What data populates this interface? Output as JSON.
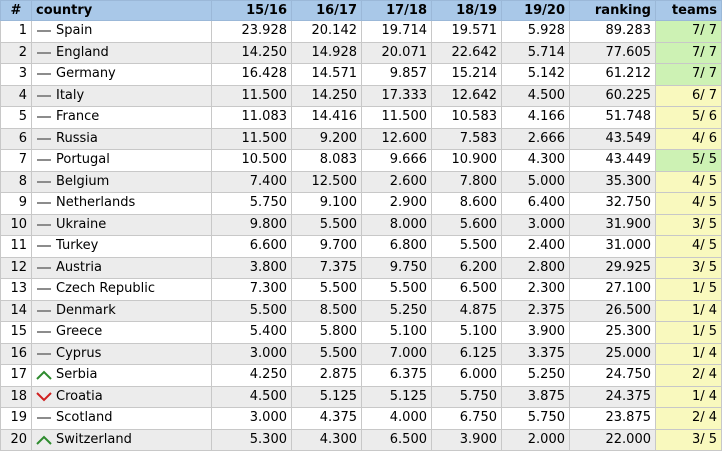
{
  "headers": {
    "rank": "#",
    "country": "country",
    "s1516": "15/16",
    "s1617": "16/17",
    "s1718": "17/18",
    "s1819": "18/19",
    "s1920": "19/20",
    "ranking": "ranking",
    "teams": "teams"
  },
  "colors": {
    "header_bg": "#a9c8e8",
    "teams_full": "#cdf2b4",
    "teams_partial": "#f9f9be",
    "up": "#2e8b2e",
    "down": "#d02020",
    "same": "#8c8c8c"
  },
  "rows": [
    {
      "rank": "1",
      "trend": "same",
      "country": "Spain",
      "s1516": "23.928",
      "s1617": "20.142",
      "s1718": "19.714",
      "s1819": "19.571",
      "s1920": "5.928",
      "ranking": "89.283",
      "teams": "7/ 7",
      "teams_status": "full"
    },
    {
      "rank": "2",
      "trend": "same",
      "country": "England",
      "s1516": "14.250",
      "s1617": "14.928",
      "s1718": "20.071",
      "s1819": "22.642",
      "s1920": "5.714",
      "ranking": "77.605",
      "teams": "7/ 7",
      "teams_status": "full"
    },
    {
      "rank": "3",
      "trend": "same",
      "country": "Germany",
      "s1516": "16.428",
      "s1617": "14.571",
      "s1718": "9.857",
      "s1819": "15.214",
      "s1920": "5.142",
      "ranking": "61.212",
      "teams": "7/ 7",
      "teams_status": "full"
    },
    {
      "rank": "4",
      "trend": "same",
      "country": "Italy",
      "s1516": "11.500",
      "s1617": "14.250",
      "s1718": "17.333",
      "s1819": "12.642",
      "s1920": "4.500",
      "ranking": "60.225",
      "teams": "6/ 7",
      "teams_status": "partial"
    },
    {
      "rank": "5",
      "trend": "same",
      "country": "France",
      "s1516": "11.083",
      "s1617": "14.416",
      "s1718": "11.500",
      "s1819": "10.583",
      "s1920": "4.166",
      "ranking": "51.748",
      "teams": "5/ 6",
      "teams_status": "partial"
    },
    {
      "rank": "6",
      "trend": "same",
      "country": "Russia",
      "s1516": "11.500",
      "s1617": "9.200",
      "s1718": "12.600",
      "s1819": "7.583",
      "s1920": "2.666",
      "ranking": "43.549",
      "teams": "4/ 6",
      "teams_status": "partial"
    },
    {
      "rank": "7",
      "trend": "same",
      "country": "Portugal",
      "s1516": "10.500",
      "s1617": "8.083",
      "s1718": "9.666",
      "s1819": "10.900",
      "s1920": "4.300",
      "ranking": "43.449",
      "teams": "5/ 5",
      "teams_status": "full"
    },
    {
      "rank": "8",
      "trend": "same",
      "country": "Belgium",
      "s1516": "7.400",
      "s1617": "12.500",
      "s1718": "2.600",
      "s1819": "7.800",
      "s1920": "5.000",
      "ranking": "35.300",
      "teams": "4/ 5",
      "teams_status": "partial"
    },
    {
      "rank": "9",
      "trend": "same",
      "country": "Netherlands",
      "s1516": "5.750",
      "s1617": "9.100",
      "s1718": "2.900",
      "s1819": "8.600",
      "s1920": "6.400",
      "ranking": "32.750",
      "teams": "4/ 5",
      "teams_status": "partial"
    },
    {
      "rank": "10",
      "trend": "same",
      "country": "Ukraine",
      "s1516": "9.800",
      "s1617": "5.500",
      "s1718": "8.000",
      "s1819": "5.600",
      "s1920": "3.000",
      "ranking": "31.900",
      "teams": "3/ 5",
      "teams_status": "partial"
    },
    {
      "rank": "11",
      "trend": "same",
      "country": "Turkey",
      "s1516": "6.600",
      "s1617": "9.700",
      "s1718": "6.800",
      "s1819": "5.500",
      "s1920": "2.400",
      "ranking": "31.000",
      "teams": "4/ 5",
      "teams_status": "partial"
    },
    {
      "rank": "12",
      "trend": "same",
      "country": "Austria",
      "s1516": "3.800",
      "s1617": "7.375",
      "s1718": "9.750",
      "s1819": "6.200",
      "s1920": "2.800",
      "ranking": "29.925",
      "teams": "3/ 5",
      "teams_status": "partial"
    },
    {
      "rank": "13",
      "trend": "same",
      "country": "Czech Republic",
      "s1516": "7.300",
      "s1617": "5.500",
      "s1718": "5.500",
      "s1819": "6.500",
      "s1920": "2.300",
      "ranking": "27.100",
      "teams": "1/ 5",
      "teams_status": "partial"
    },
    {
      "rank": "14",
      "trend": "same",
      "country": "Denmark",
      "s1516": "5.500",
      "s1617": "8.500",
      "s1718": "5.250",
      "s1819": "4.875",
      "s1920": "2.375",
      "ranking": "26.500",
      "teams": "1/ 4",
      "teams_status": "partial"
    },
    {
      "rank": "15",
      "trend": "same",
      "country": "Greece",
      "s1516": "5.400",
      "s1617": "5.800",
      "s1718": "5.100",
      "s1819": "5.100",
      "s1920": "3.900",
      "ranking": "25.300",
      "teams": "1/ 5",
      "teams_status": "partial"
    },
    {
      "rank": "16",
      "trend": "same",
      "country": "Cyprus",
      "s1516": "3.000",
      "s1617": "5.500",
      "s1718": "7.000",
      "s1819": "6.125",
      "s1920": "3.375",
      "ranking": "25.000",
      "teams": "1/ 4",
      "teams_status": "partial"
    },
    {
      "rank": "17",
      "trend": "up",
      "country": "Serbia",
      "s1516": "4.250",
      "s1617": "2.875",
      "s1718": "6.375",
      "s1819": "6.000",
      "s1920": "5.250",
      "ranking": "24.750",
      "teams": "2/ 4",
      "teams_status": "partial"
    },
    {
      "rank": "18",
      "trend": "down",
      "country": "Croatia",
      "s1516": "4.500",
      "s1617": "5.125",
      "s1718": "5.125",
      "s1819": "5.750",
      "s1920": "3.875",
      "ranking": "24.375",
      "teams": "1/ 4",
      "teams_status": "partial"
    },
    {
      "rank": "19",
      "trend": "same",
      "country": "Scotland",
      "s1516": "3.000",
      "s1617": "4.375",
      "s1718": "4.000",
      "s1819": "6.750",
      "s1920": "5.750",
      "ranking": "23.875",
      "teams": "2/ 4",
      "teams_status": "partial"
    },
    {
      "rank": "20",
      "trend": "up",
      "country": "Switzerland",
      "s1516": "5.300",
      "s1617": "4.300",
      "s1718": "6.500",
      "s1819": "3.900",
      "s1920": "2.000",
      "ranking": "22.000",
      "teams": "3/ 5",
      "teams_status": "partial"
    }
  ]
}
